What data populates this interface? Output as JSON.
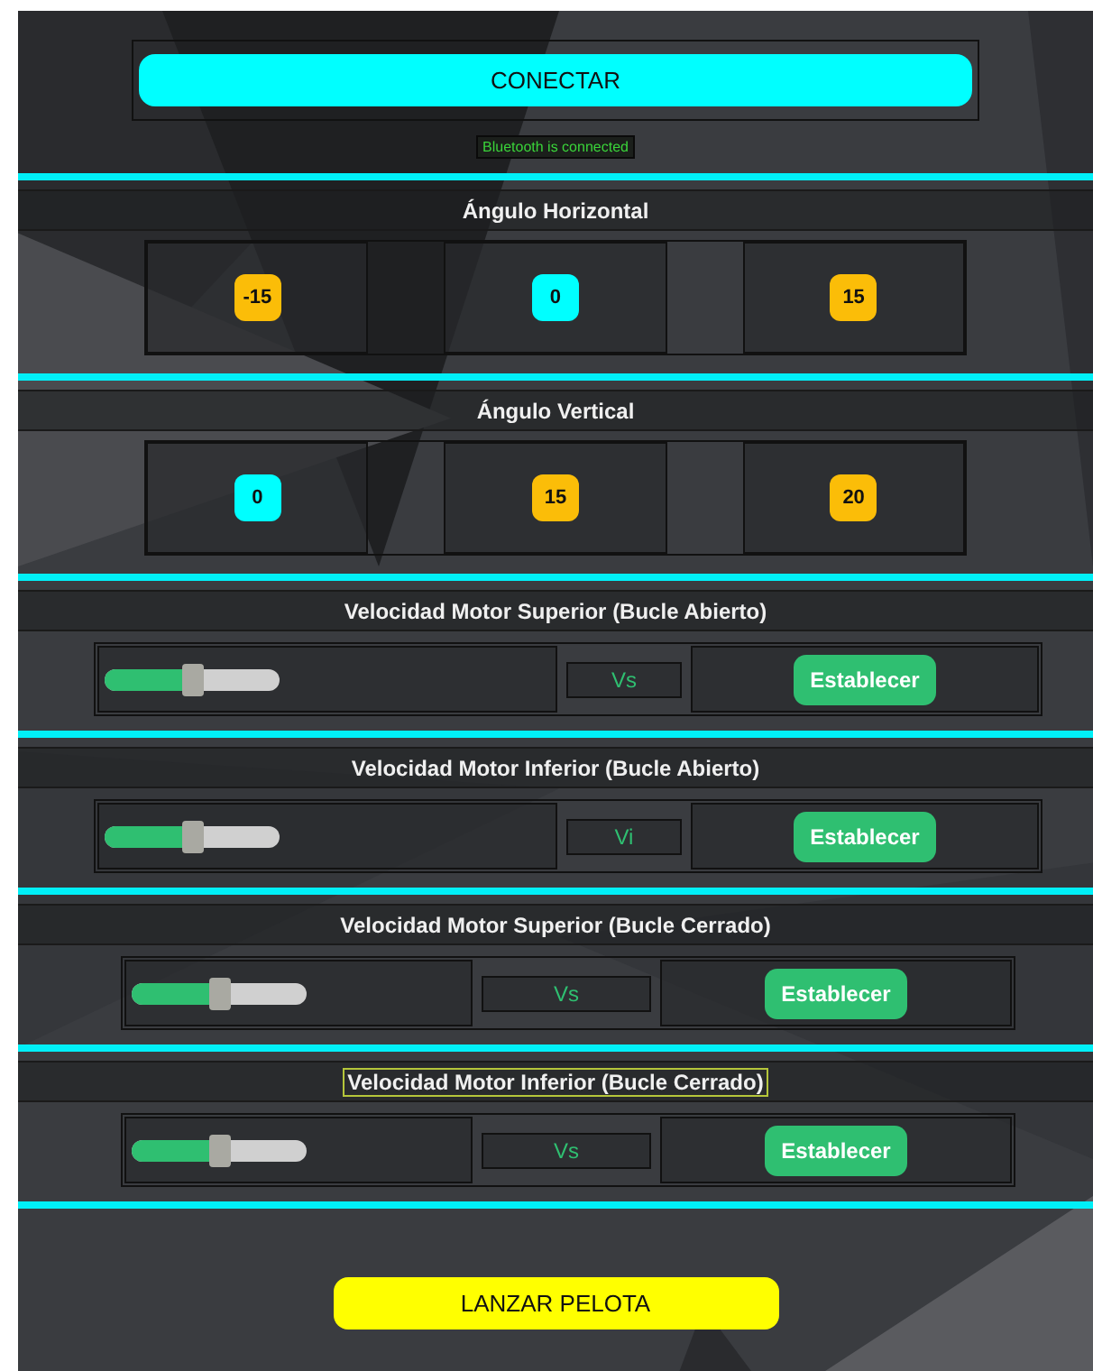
{
  "connect": {
    "button": "CONECTAR",
    "status": "Bluetooth is connected"
  },
  "angles": [
    {
      "title": "Ángulo Horizontal",
      "options": [
        {
          "label": "-15",
          "selected": false
        },
        {
          "label": "0",
          "selected": true
        },
        {
          "label": "15",
          "selected": false
        }
      ]
    },
    {
      "title": "Ángulo Vertical",
      "options": [
        {
          "label": "0",
          "selected": true
        },
        {
          "label": "15",
          "selected": false
        },
        {
          "label": "20",
          "selected": false
        }
      ]
    }
  ],
  "motors": [
    {
      "kind": "open",
      "title": "Velocidad Motor Superior (Bucle Abierto)",
      "focused": false,
      "level": 0.5,
      "value": "Vs",
      "button": "Establecer"
    },
    {
      "kind": "open",
      "title": "Velocidad Motor Inferior (Bucle Abierto)",
      "focused": false,
      "level": 0.5,
      "value": "Vi",
      "button": "Establecer"
    },
    {
      "kind": "closed",
      "title": "Velocidad Motor Superior (Bucle Cerrado)",
      "focused": false,
      "level": 0.5,
      "value": "Vs",
      "button": "Establecer"
    },
    {
      "kind": "closed",
      "title": "Velocidad Motor Inferior (Bucle Cerrado)",
      "focused": true,
      "level": 0.5,
      "value": "Vs",
      "button": "Establecer"
    }
  ],
  "launch": {
    "button": "LANZAR PELOTA"
  }
}
